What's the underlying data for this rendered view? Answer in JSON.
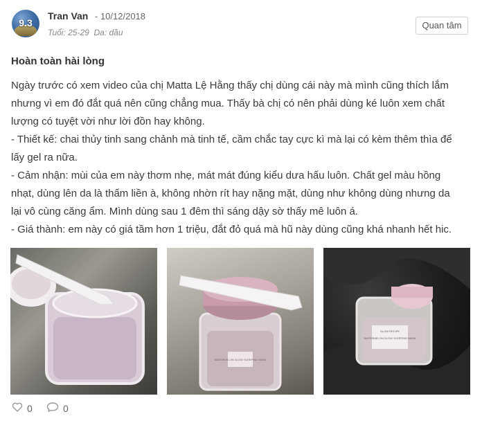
{
  "author": {
    "name": "Tran Van",
    "date": "- 10/12/2018",
    "age": "Tuổi: 25-29",
    "skin": "Da: dầu",
    "score": "9.3"
  },
  "follow_label": "Quan tâm",
  "review": {
    "title": "Hoàn toàn hài lòng",
    "lines": [
      "Ngày trước có xem video của chị Matta Lệ Hằng thấy chị dùng cái này mà mình cũng thích lắm",
      "nhưng vì em đó đắt quá nên cũng chẳng mua. Thấy bà chị có nên phải dùng ké luôn xem chất",
      "lượng có tuyệt vời như lời đồn hay không.",
      "- Thiết kế: chai thủy tinh sang chảnh mà tinh tế, cầm chắc tay cực kì mà lại có kèm thêm thìa để",
      "lấy gel ra nữa.",
      "- Cảm nhận: mùi của em này thơm nhẹ, mát mát đúng kiểu dưa hấu luôn. Chất gel màu hồng",
      "nhạt, dùng lên da là thấm liền à, không nhờn rít hay nặng mặt, dùng như không dùng nhưng da",
      "lại vô cùng căng ẩm. Mình dùng sau 1 đêm thì sáng dậy sờ thấy mê luôn á.",
      "- Giá thành: em này có giá tầm hơn 1 triệu, đắt đỏ quá mà hũ này dùng cũng khá nhanh hết hic."
    ]
  },
  "photos": {
    "jar_label": "WATERMELON GLOW SLEEPING MASK",
    "brand_label": "GLOW RECIPE"
  },
  "stats": {
    "likes": "0",
    "comments": "0"
  }
}
